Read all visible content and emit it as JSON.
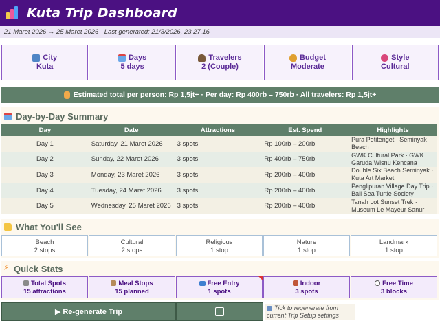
{
  "header": {
    "title": "Kuta Trip Dashboard",
    "subtitle": "21 Maret 2026 → 25 Maret 2026  ·  Last generated: 21/3/2026, 23.27.16"
  },
  "summary_cards": [
    {
      "icon": "city-icon",
      "label": "City",
      "value": "Kuta"
    },
    {
      "icon": "calendar-icon",
      "label": "Days",
      "value": "5 days"
    },
    {
      "icon": "travelers-icon",
      "label": "Travelers",
      "value": "2 (Couple)"
    },
    {
      "icon": "money-bag-icon",
      "label": "Budget",
      "value": "Moderate"
    },
    {
      "icon": "palette-icon",
      "label": "Style",
      "value": "Cultural"
    }
  ],
  "estimate_banner": "Estimated total per person: Rp 1,5jt+  ·  Per day: Rp 400rb – 750rb  ·  All travelers: Rp 1,5jt+",
  "day_summary": {
    "heading": "Day-by-Day Summary",
    "columns": [
      "Day",
      "Date",
      "Attractions",
      "Est. Spend",
      "Highlights"
    ],
    "rows": [
      {
        "day": "Day 1",
        "date": "Saturday, 21 Maret 2026",
        "attractions": "3 spots",
        "spend": "Rp 100rb – 200rb",
        "highlights": "Pura Petitenget · Seminyak Beach"
      },
      {
        "day": "Day 2",
        "date": "Sunday, 22 Maret 2026",
        "attractions": "3 spots",
        "spend": "Rp 400rb – 750rb",
        "highlights": "GWK Cultural Park · GWK Garuda Wisnu Kencana"
      },
      {
        "day": "Day 3",
        "date": "Monday, 23 Maret 2026",
        "attractions": "3 spots",
        "spend": "Rp 200rb – 400rb",
        "highlights": "Double Six Beach Seminyak · Kuta Art Market"
      },
      {
        "day": "Day 4",
        "date": "Tuesday, 24 Maret 2026",
        "attractions": "3 spots",
        "spend": "Rp 200rb – 400rb",
        "highlights": "Penglipuran Village Day Trip · Bali Sea Turtle Society"
      },
      {
        "day": "Day 5",
        "date": "Wednesday, 25 Maret 2026",
        "attractions": "3 spots",
        "spend": "Rp 200rb – 400rb",
        "highlights": "Tanah Lot Sunset Trek · Museum Le Mayeur Sanur"
      }
    ]
  },
  "what_youll_see": {
    "heading": "What You'll See",
    "items": [
      {
        "label": "Beach",
        "count": "2 stops"
      },
      {
        "label": "Cultural",
        "count": "2 stops"
      },
      {
        "label": "Religious",
        "count": "1 stop"
      },
      {
        "label": "Nature",
        "count": "1 stop"
      },
      {
        "label": "Landmark",
        "count": "1 stop"
      }
    ]
  },
  "quick_stats": {
    "heading": "Quick Stats",
    "items": [
      {
        "icon": "building-icon",
        "label": "Total Spots",
        "value": "15 attractions"
      },
      {
        "icon": "meal-icon",
        "label": "Meal Stops",
        "value": "15 planned"
      },
      {
        "icon": "ticket-icon",
        "label": "Free Entry",
        "value": "1 spots"
      },
      {
        "icon": "indoor-icon",
        "label": "Indoor",
        "value": "3 spots"
      },
      {
        "icon": "clock-icon",
        "label": "Free Time",
        "value": "3 blocks"
      }
    ]
  },
  "actions": {
    "regen_label": "▶ Re-generate Trip",
    "hint": "Tick to regenerate from current Trip Setup settings"
  },
  "colors": {
    "header_purple": "#4b1182",
    "accent_green": "#5f7f6a",
    "card_border": "#8d5bc6"
  }
}
